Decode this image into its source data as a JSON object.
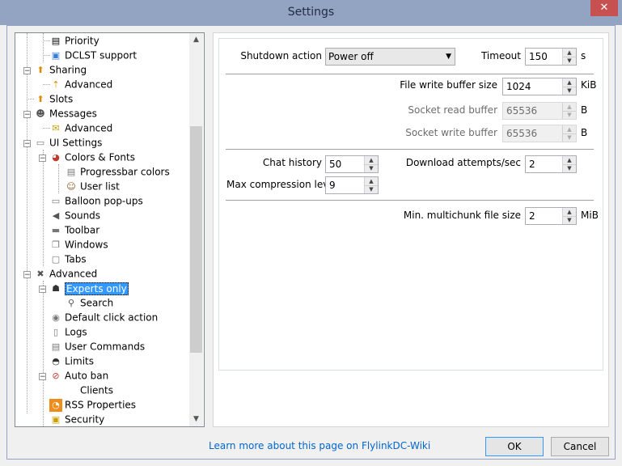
{
  "window": {
    "title": "Settings",
    "close_glyph": "✕"
  },
  "tree": {
    "items": [
      {
        "label": "Priority",
        "icon": "priority-icon"
      },
      {
        "label": "DCLST support",
        "icon": "dclst-icon"
      },
      {
        "label": "Sharing",
        "icon": "sharing-icon"
      },
      {
        "label": "Advanced",
        "icon": "sharing-advanced-icon"
      },
      {
        "label": "Slots",
        "icon": "slots-icon"
      },
      {
        "label": "Messages",
        "icon": "messages-icon"
      },
      {
        "label": "Advanced",
        "icon": "messages-advanced-icon"
      },
      {
        "label": "UI Settings",
        "icon": "ui-settings-icon"
      },
      {
        "label": "Colors & Fonts",
        "icon": "palette-icon"
      },
      {
        "label": "Progressbar colors",
        "icon": "progressbar-icon"
      },
      {
        "label": "User list",
        "icon": "user-list-icon"
      },
      {
        "label": "Balloon pop-ups",
        "icon": "balloon-icon"
      },
      {
        "label": "Sounds",
        "icon": "speaker-icon"
      },
      {
        "label": "Toolbar",
        "icon": "toolbar-icon"
      },
      {
        "label": "Windows",
        "icon": "windows-icon"
      },
      {
        "label": "Tabs",
        "icon": "tabs-icon"
      },
      {
        "label": "Advanced",
        "icon": "tools-icon"
      },
      {
        "label": "Experts only",
        "icon": "expert-user-icon"
      },
      {
        "label": "Search",
        "icon": "search-icon"
      },
      {
        "label": "Default click action",
        "icon": "mouse-icon"
      },
      {
        "label": "Logs",
        "icon": "logs-icon"
      },
      {
        "label": "User Commands",
        "icon": "user-commands-icon"
      },
      {
        "label": "Limits",
        "icon": "gauge-icon"
      },
      {
        "label": "Auto ban",
        "icon": "auto-ban-icon"
      },
      {
        "label": "Clients",
        "icon": "clients-icon"
      },
      {
        "label": "RSS Properties",
        "icon": "rss-icon"
      },
      {
        "label": "Security",
        "icon": "lock-icon"
      }
    ]
  },
  "form": {
    "shutdown_action_label": "Shutdown action",
    "shutdown_action_value": "Power off",
    "timeout_label": "Timeout",
    "timeout_value": "150",
    "timeout_unit": "s",
    "file_write_buffer_label": "File write buffer size",
    "file_write_buffer_value": "1024",
    "file_write_buffer_unit": "KiB",
    "socket_read_buffer_label": "Socket read buffer",
    "socket_read_buffer_value": "65536",
    "socket_read_buffer_unit": "B",
    "socket_write_buffer_label": "Socket write buffer",
    "socket_write_buffer_value": "65536",
    "socket_write_buffer_unit": "B",
    "chat_history_label": "Chat history",
    "chat_history_value": "50",
    "download_attempts_label": "Download attempts/sec",
    "download_attempts_value": "2",
    "max_compression_label": "Max compression level",
    "max_compression_value": "9",
    "min_multichunk_label": "Min. multichunk file size",
    "min_multichunk_value": "2",
    "min_multichunk_unit": "MiB"
  },
  "footer": {
    "help_link": "Learn more about this page on FlylinkDC-Wiki",
    "ok_label": "OK",
    "cancel_label": "Cancel"
  }
}
